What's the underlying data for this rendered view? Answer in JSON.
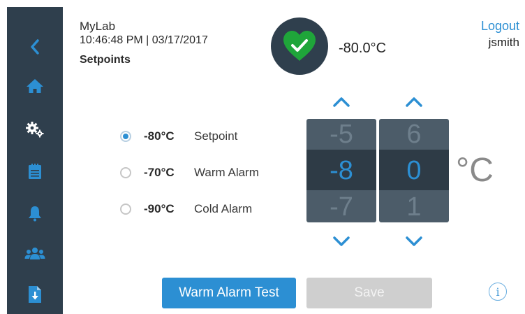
{
  "header": {
    "site_name": "MyLab",
    "datetime": "10:46:48 PM | 03/17/2017",
    "page_title": "Setpoints",
    "current_temperature": "-80.0°C",
    "status": "ok",
    "logout_label": "Logout",
    "username": "jsmith"
  },
  "sidebar": {
    "items": [
      {
        "name": "back",
        "icon": "chevron-left-icon"
      },
      {
        "name": "home",
        "icon": "home-icon"
      },
      {
        "name": "settings",
        "icon": "gears-icon",
        "active": true
      },
      {
        "name": "log",
        "icon": "clipboard-icon"
      },
      {
        "name": "alarms",
        "icon": "bell-icon"
      },
      {
        "name": "users",
        "icon": "users-icon"
      },
      {
        "name": "export",
        "icon": "file-download-icon"
      }
    ]
  },
  "setpoints": {
    "options": [
      {
        "value": "-80°C",
        "label": "Setpoint",
        "selected": true
      },
      {
        "value": "-70°C",
        "label": "Warm Alarm",
        "selected": false
      },
      {
        "value": "-90°C",
        "label": "Cold Alarm",
        "selected": false
      }
    ]
  },
  "rollers": {
    "tens": {
      "prev": "-5",
      "current": "-8",
      "next": "-7"
    },
    "ones": {
      "prev": "6",
      "current": "0",
      "next": "1"
    },
    "unit": "°C"
  },
  "buttons": {
    "warm_alarm_test": "Warm Alarm Test",
    "save": "Save"
  },
  "info_symbol": "i",
  "colors": {
    "sidebar": "#2f3f4d",
    "accent": "#2c8fd3",
    "status_ok": "#1fa53a",
    "roller_bg": "#4c5c69",
    "disabled": "#cfcfcf"
  }
}
